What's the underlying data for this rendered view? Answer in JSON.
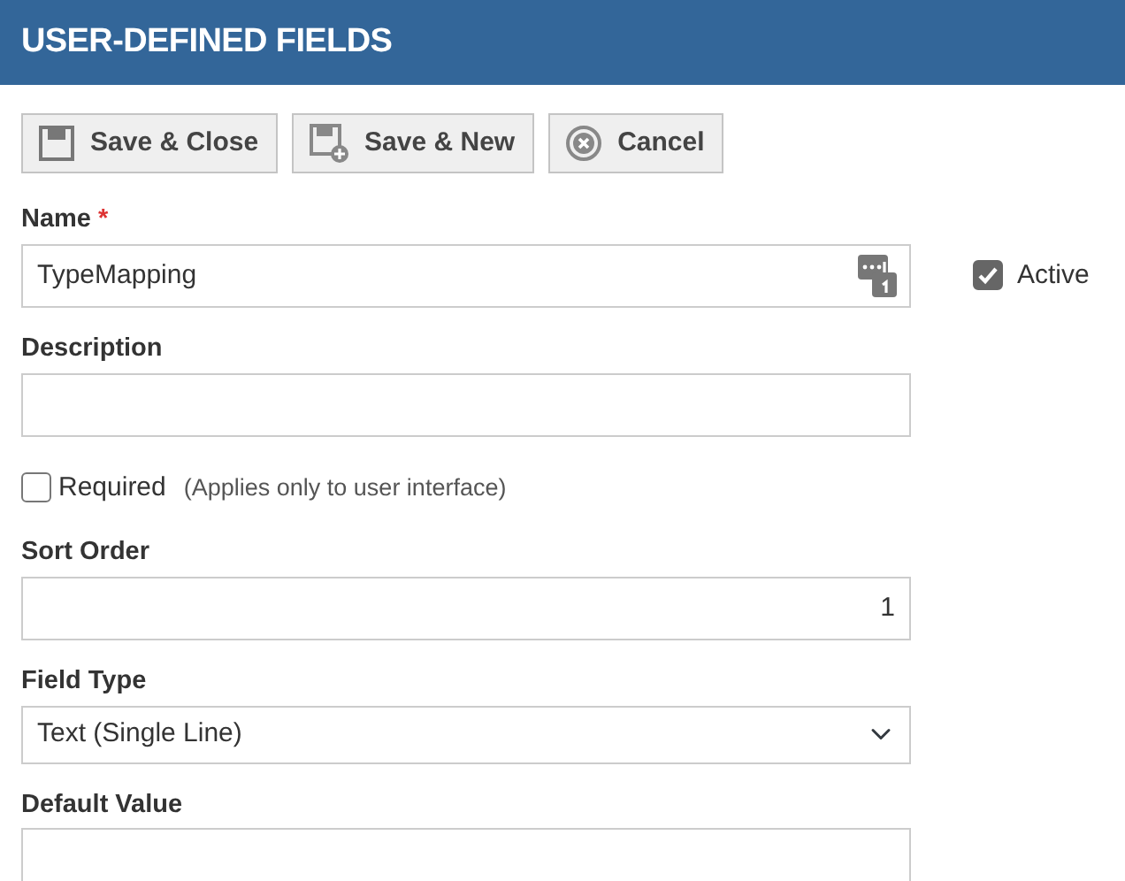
{
  "header": {
    "title": "USER-DEFINED FIELDS"
  },
  "buttons": [
    {
      "label": "Save & Close",
      "kind": "save"
    },
    {
      "label": "Save & New",
      "kind": "save-new"
    },
    {
      "label": "Cancel",
      "kind": "cancel"
    }
  ],
  "name_field": {
    "label": "Name",
    "required_mark": "*",
    "value": "TypeMapping"
  },
  "active": {
    "label": "Active",
    "checked": true
  },
  "description_field": {
    "label": "Description"
  },
  "required": {
    "label": "Required",
    "checked": false,
    "note": "(Applies only to user interface)"
  },
  "sort_order_field": {
    "label": "Sort Order",
    "value": "1"
  },
  "field_type_field": {
    "label": "Field Type",
    "value": "Text (Single Line)"
  },
  "default_value_field": {
    "label": "Default Value"
  }
}
